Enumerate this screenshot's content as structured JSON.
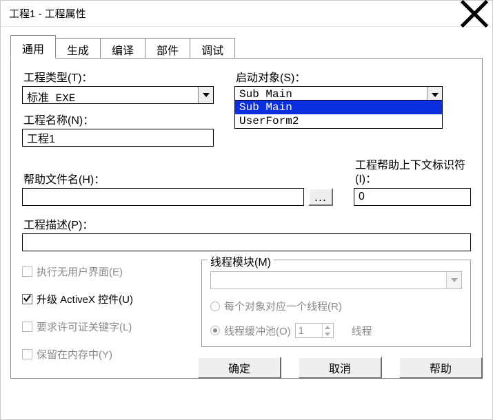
{
  "title": "工程1 - 工程属性",
  "tabs": [
    "通用",
    "生成",
    "编译",
    "部件",
    "调试"
  ],
  "active_tab": 0,
  "project_type": {
    "label": "工程类型(T)：",
    "value": "标准 EXE"
  },
  "startup": {
    "label": "启动对象(S)：",
    "value": "Sub Main",
    "options": [
      "Sub Main",
      "UserForm2"
    ],
    "open": true,
    "selected_index": 0
  },
  "project_name": {
    "label": "工程名称(N)：",
    "value": "工程1"
  },
  "help_file": {
    "label": "帮助文件名(H)：",
    "value": "",
    "browse": "..."
  },
  "context_id": {
    "label": "工程帮助上下文标识符(I)：",
    "value": "0"
  },
  "project_desc": {
    "label": "工程描述(P)：",
    "value": ""
  },
  "checks": {
    "unattended": {
      "label": "执行无用户界面(E)",
      "checked": false,
      "enabled": false
    },
    "upgrade_activex": {
      "label": "升级 ActiveX 控件(U)",
      "checked": true,
      "enabled": true
    },
    "license_key": {
      "label": "要求许可证关键字(L)",
      "checked": false,
      "enabled": false
    },
    "retain_memory": {
      "label": "保留在内存中(Y)",
      "checked": false,
      "enabled": false
    }
  },
  "thread": {
    "legend": "线程模块(M)",
    "combo_value": "",
    "radio_per_object": "每个对象对应一个线程(R)",
    "radio_pool": "线程缓冲池(O)",
    "pool_value": "1",
    "suffix": "线程",
    "selected": "pool"
  },
  "buttons": {
    "ok": "确定",
    "cancel": "取消",
    "help": "帮助"
  }
}
